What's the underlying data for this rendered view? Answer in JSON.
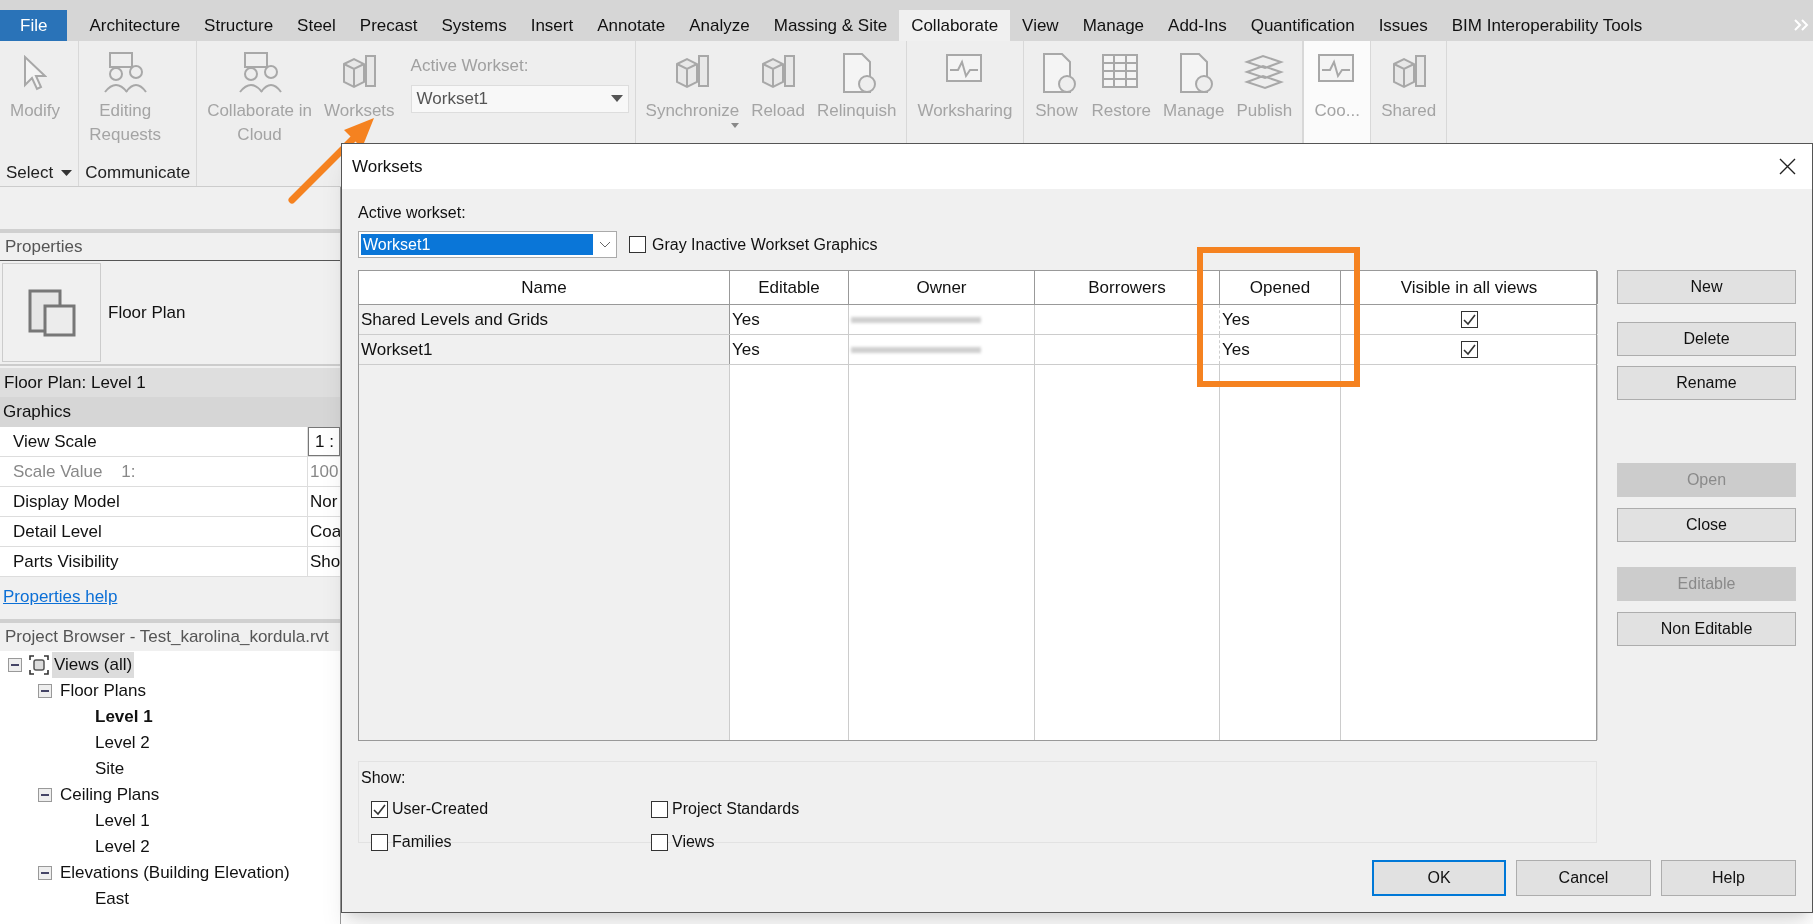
{
  "ribbon_tabs": [
    {
      "label": "File",
      "kind": "file",
      "selected": false
    },
    {
      "label": "Architecture",
      "kind": "tab",
      "selected": false
    },
    {
      "label": "Structure",
      "kind": "tab",
      "selected": false
    },
    {
      "label": "Steel",
      "kind": "tab",
      "selected": false
    },
    {
      "label": "Precast",
      "kind": "tab",
      "selected": false
    },
    {
      "label": "Systems",
      "kind": "tab",
      "selected": false
    },
    {
      "label": "Insert",
      "kind": "tab",
      "selected": false
    },
    {
      "label": "Annotate",
      "kind": "tab",
      "selected": false
    },
    {
      "label": "Analyze",
      "kind": "tab",
      "selected": false
    },
    {
      "label": "Massing & Site",
      "kind": "tab",
      "selected": false
    },
    {
      "label": "Collaborate",
      "kind": "tab",
      "selected": true
    },
    {
      "label": "View",
      "kind": "tab",
      "selected": false
    },
    {
      "label": "Manage",
      "kind": "tab",
      "selected": false
    },
    {
      "label": "Add-Ins",
      "kind": "tab",
      "selected": false
    },
    {
      "label": "Quantification",
      "kind": "tab",
      "selected": false
    },
    {
      "label": "Issues",
      "kind": "tab",
      "selected": false
    },
    {
      "label": "BIM Interoperability Tools",
      "kind": "tab",
      "selected": false
    }
  ],
  "ribbon_panels": [
    {
      "label": "Select",
      "dropdown": true,
      "highlighted": false,
      "items": [
        {
          "kind": "cursor",
          "lines": [
            "Modify"
          ]
        }
      ]
    },
    {
      "label": "Communicate",
      "dropdown": false,
      "highlighted": false,
      "items": [
        {
          "kind": "person-lock",
          "lines": [
            "Editing",
            "Requests"
          ]
        }
      ]
    },
    {
      "highlighted": false,
      "items": [
        {
          "kind": "people",
          "lines": [
            "Collaborate in",
            "Cloud"
          ]
        },
        {
          "kind": "cubes",
          "lines": [
            "Worksets"
          ]
        },
        {
          "kind": "active-workset",
          "label": "Active Workset:",
          "value": "Workset1"
        }
      ]
    },
    {
      "highlighted": false,
      "items": [
        {
          "kind": "sync",
          "lines": [
            "Synchronize"
          ],
          "dropdown": true
        },
        {
          "kind": "reload",
          "lines": [
            "Reload"
          ]
        },
        {
          "kind": "relinquish",
          "lines": [
            "Relinquish"
          ]
        }
      ]
    },
    {
      "highlighted": false,
      "items": [
        {
          "kind": "monitor",
          "lines": [
            "Worksharing"
          ]
        }
      ]
    },
    {
      "highlighted": false,
      "items": [
        {
          "kind": "history",
          "lines": [
            "Show"
          ]
        },
        {
          "kind": "table",
          "lines": [
            "Restore"
          ]
        },
        {
          "kind": "cloud-doc",
          "lines": [
            "Manage"
          ]
        },
        {
          "kind": "stack",
          "lines": [
            "Publish"
          ]
        }
      ]
    },
    {
      "highlighted": true,
      "items": [
        {
          "kind": "monitor-wave",
          "lines": [
            "Coo..."
          ]
        }
      ]
    },
    {
      "highlighted": false,
      "items": [
        {
          "kind": "cube-share",
          "lines": [
            "Shared"
          ]
        }
      ]
    }
  ],
  "properties": {
    "title": "Properties",
    "type_name": "Floor Plan",
    "view_selector": "Floor Plan: Level 1",
    "category": "Graphics",
    "rows": [
      {
        "name": "View Scale",
        "value": "1 :",
        "disabled": false,
        "kind": "field"
      },
      {
        "name": "Scale Value    1:",
        "value": "100",
        "disabled": true,
        "kind": "text"
      },
      {
        "name": "Display Model",
        "value": "Nor",
        "disabled": false,
        "kind": "text"
      },
      {
        "name": "Detail Level",
        "value": "Coa",
        "disabled": false,
        "kind": "text"
      },
      {
        "name": "Parts Visibility",
        "value": "Sho",
        "disabled": false,
        "kind": "text"
      }
    ],
    "help_link": "Properties help"
  },
  "project_browser": {
    "title": "Project Browser - Test_karolina_kordula.rvt",
    "tree": [
      {
        "label": "Views (all)",
        "expanded": true,
        "selected": true,
        "children": [
          {
            "label": "Floor Plans",
            "expanded": true,
            "children": [
              {
                "label": "Level 1",
                "current": true
              },
              {
                "label": "Level 2",
                "current": false
              },
              {
                "label": "Site",
                "current": false
              }
            ]
          },
          {
            "label": "Ceiling Plans",
            "expanded": true,
            "children": [
              {
                "label": "Level 1",
                "current": false
              },
              {
                "label": "Level 2",
                "current": false
              }
            ]
          },
          {
            "label": "Elevations (Building Elevation)",
            "expanded": true,
            "children": [
              {
                "label": "East",
                "current": false
              }
            ]
          }
        ]
      }
    ]
  },
  "dialog": {
    "title": "Worksets",
    "active_workset_label": "Active workset:",
    "active_workset": "Workset1",
    "gray_inactive": {
      "label": "Gray Inactive Workset Graphics",
      "checked": false
    },
    "columns": [
      "Name",
      "Editable",
      "Owner",
      "Borrowers",
      "Opened",
      "Visible in all views"
    ],
    "rows": [
      {
        "name": "Shared Levels and Grids",
        "editable": "Yes",
        "opened": "Yes",
        "visible": true
      },
      {
        "name": "Workset1",
        "editable": "Yes",
        "opened": "Yes",
        "visible": true
      }
    ],
    "show_label": "Show:",
    "show_options": [
      {
        "label": "User-Created",
        "checked": true
      },
      {
        "label": "Project Standards",
        "checked": false
      },
      {
        "label": "Families",
        "checked": false
      },
      {
        "label": "Views",
        "checked": false
      }
    ],
    "side_buttons": [
      {
        "label": "New",
        "disabled": false
      },
      {
        "label": "Delete",
        "disabled": false
      },
      {
        "label": "Rename",
        "disabled": false
      },
      {
        "label": "Open",
        "disabled": true
      },
      {
        "label": "Close",
        "disabled": false
      },
      {
        "label": "Editable",
        "disabled": true
      },
      {
        "label": "Non Editable",
        "disabled": false
      }
    ],
    "footer_buttons": [
      {
        "label": "OK",
        "default": true
      },
      {
        "label": "Cancel",
        "default": false
      },
      {
        "label": "Help",
        "default": false
      }
    ]
  }
}
